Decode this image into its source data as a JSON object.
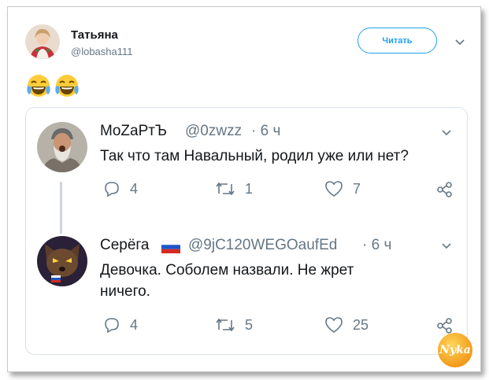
{
  "tweet": {
    "author_name": "Татьяна",
    "author_handle": "@lobasha111",
    "follow_label": "Читать",
    "body_emoji": "😂😂"
  },
  "reply1": {
    "name": "MoZaPтЪ",
    "handle": "@0zwzz",
    "time": "· 6 ч",
    "text": "Так что там Навальный, родил уже или нет?",
    "replies": "4",
    "retweets": "1",
    "likes": "7"
  },
  "reply2": {
    "name": "Серёга",
    "handle": "@9jC120WEGOaufEd",
    "time": "· 6 ч",
    "text_line1": "Девочка. Соболем назвали. Не жрет",
    "text_line2": "ничего.",
    "replies": "4",
    "retweets": "5",
    "likes": "25"
  },
  "watermark": "Nyka",
  "colors": {
    "accent": "#1da1f2",
    "muted": "#657786",
    "border": "#d9e1e8"
  }
}
